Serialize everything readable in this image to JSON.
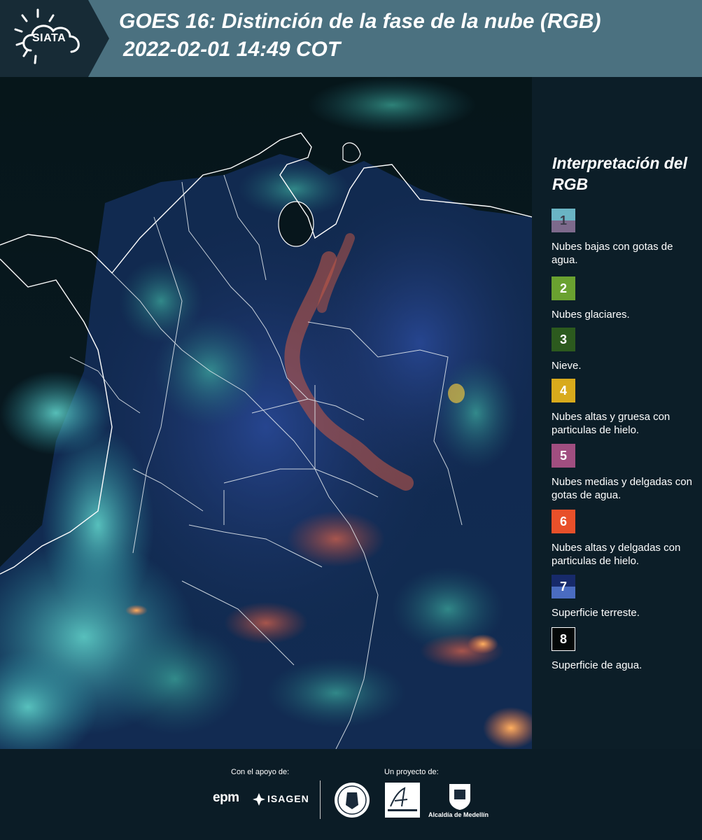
{
  "header": {
    "logo_text": "SIATA",
    "title_line1": "GOES 16: Distinción de la fase de la nube (RGB)",
    "title_line2": "2022-02-01 14:49 COT",
    "background_color": "#4b7180"
  },
  "legend": {
    "title": "Interpretación del RGB",
    "items": [
      {
        "number": "1",
        "label": "Nubes bajas con gotas de agua.",
        "color_top": "#6ab4c4",
        "color_bottom": "#7d6a8c",
        "number_color": "#3b3b4a"
      },
      {
        "number": "2",
        "label": "Nubes glaciares.",
        "color_top": "#6aa130",
        "color_bottom": "#6aa130",
        "number_color": "#ffffff"
      },
      {
        "number": "3",
        "label": "Nieve.",
        "color_top": "#2c5a1e",
        "color_bottom": "#2c5a1e",
        "number_color": "#ffffff"
      },
      {
        "number": "4",
        "label": "Nubes altas y gruesa con particulas de hielo.",
        "color_top": "#d8aa1c",
        "color_bottom": "#d8aa1c",
        "number_color": "#ffffff"
      },
      {
        "number": "5",
        "label": "Nubes medias y delgadas con gotas de agua.",
        "color_top": "#a04e80",
        "color_bottom": "#a04e80",
        "number_color": "#ffffff"
      },
      {
        "number": "6",
        "label": "Nubes altas y delgadas con particulas de hielo.",
        "color_top": "#e8502a",
        "color_bottom": "#e8502a",
        "number_color": "#ffffff"
      },
      {
        "number": "7",
        "label": "Superficie terreste.",
        "color_top": "#172a6a",
        "color_bottom": "#4a6cc0",
        "number_color": "#ffffff"
      },
      {
        "number": "8",
        "label": "Superficie de agua.",
        "color_top": "#050808",
        "color_bottom": "#050808",
        "number_color": "#ffffff"
      }
    ]
  },
  "footer": {
    "support_label": "Con el apoyo de:",
    "project_label": "Un proyecto de:",
    "sponsor_1": "epm",
    "sponsor_2": "ISAGEN",
    "partner_3": "Alcaldía de Medellín"
  }
}
